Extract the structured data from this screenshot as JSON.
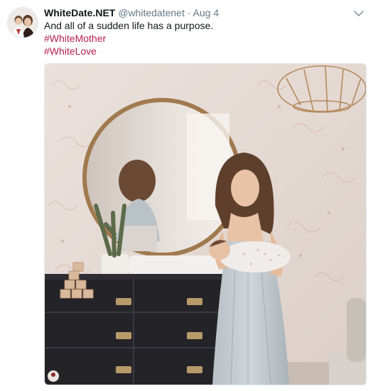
{
  "tweet": {
    "display_name": "WhiteDate.NET",
    "handle": "@whitedatenet",
    "separator": "·",
    "date": "Aug 4",
    "text": "And all of a sudden life has a purpose.",
    "hashtags": [
      "#WhiteMother",
      "#WhiteLove"
    ],
    "more_icon": "chevron-down-icon",
    "hashtag_color": "#b41e4d"
  }
}
